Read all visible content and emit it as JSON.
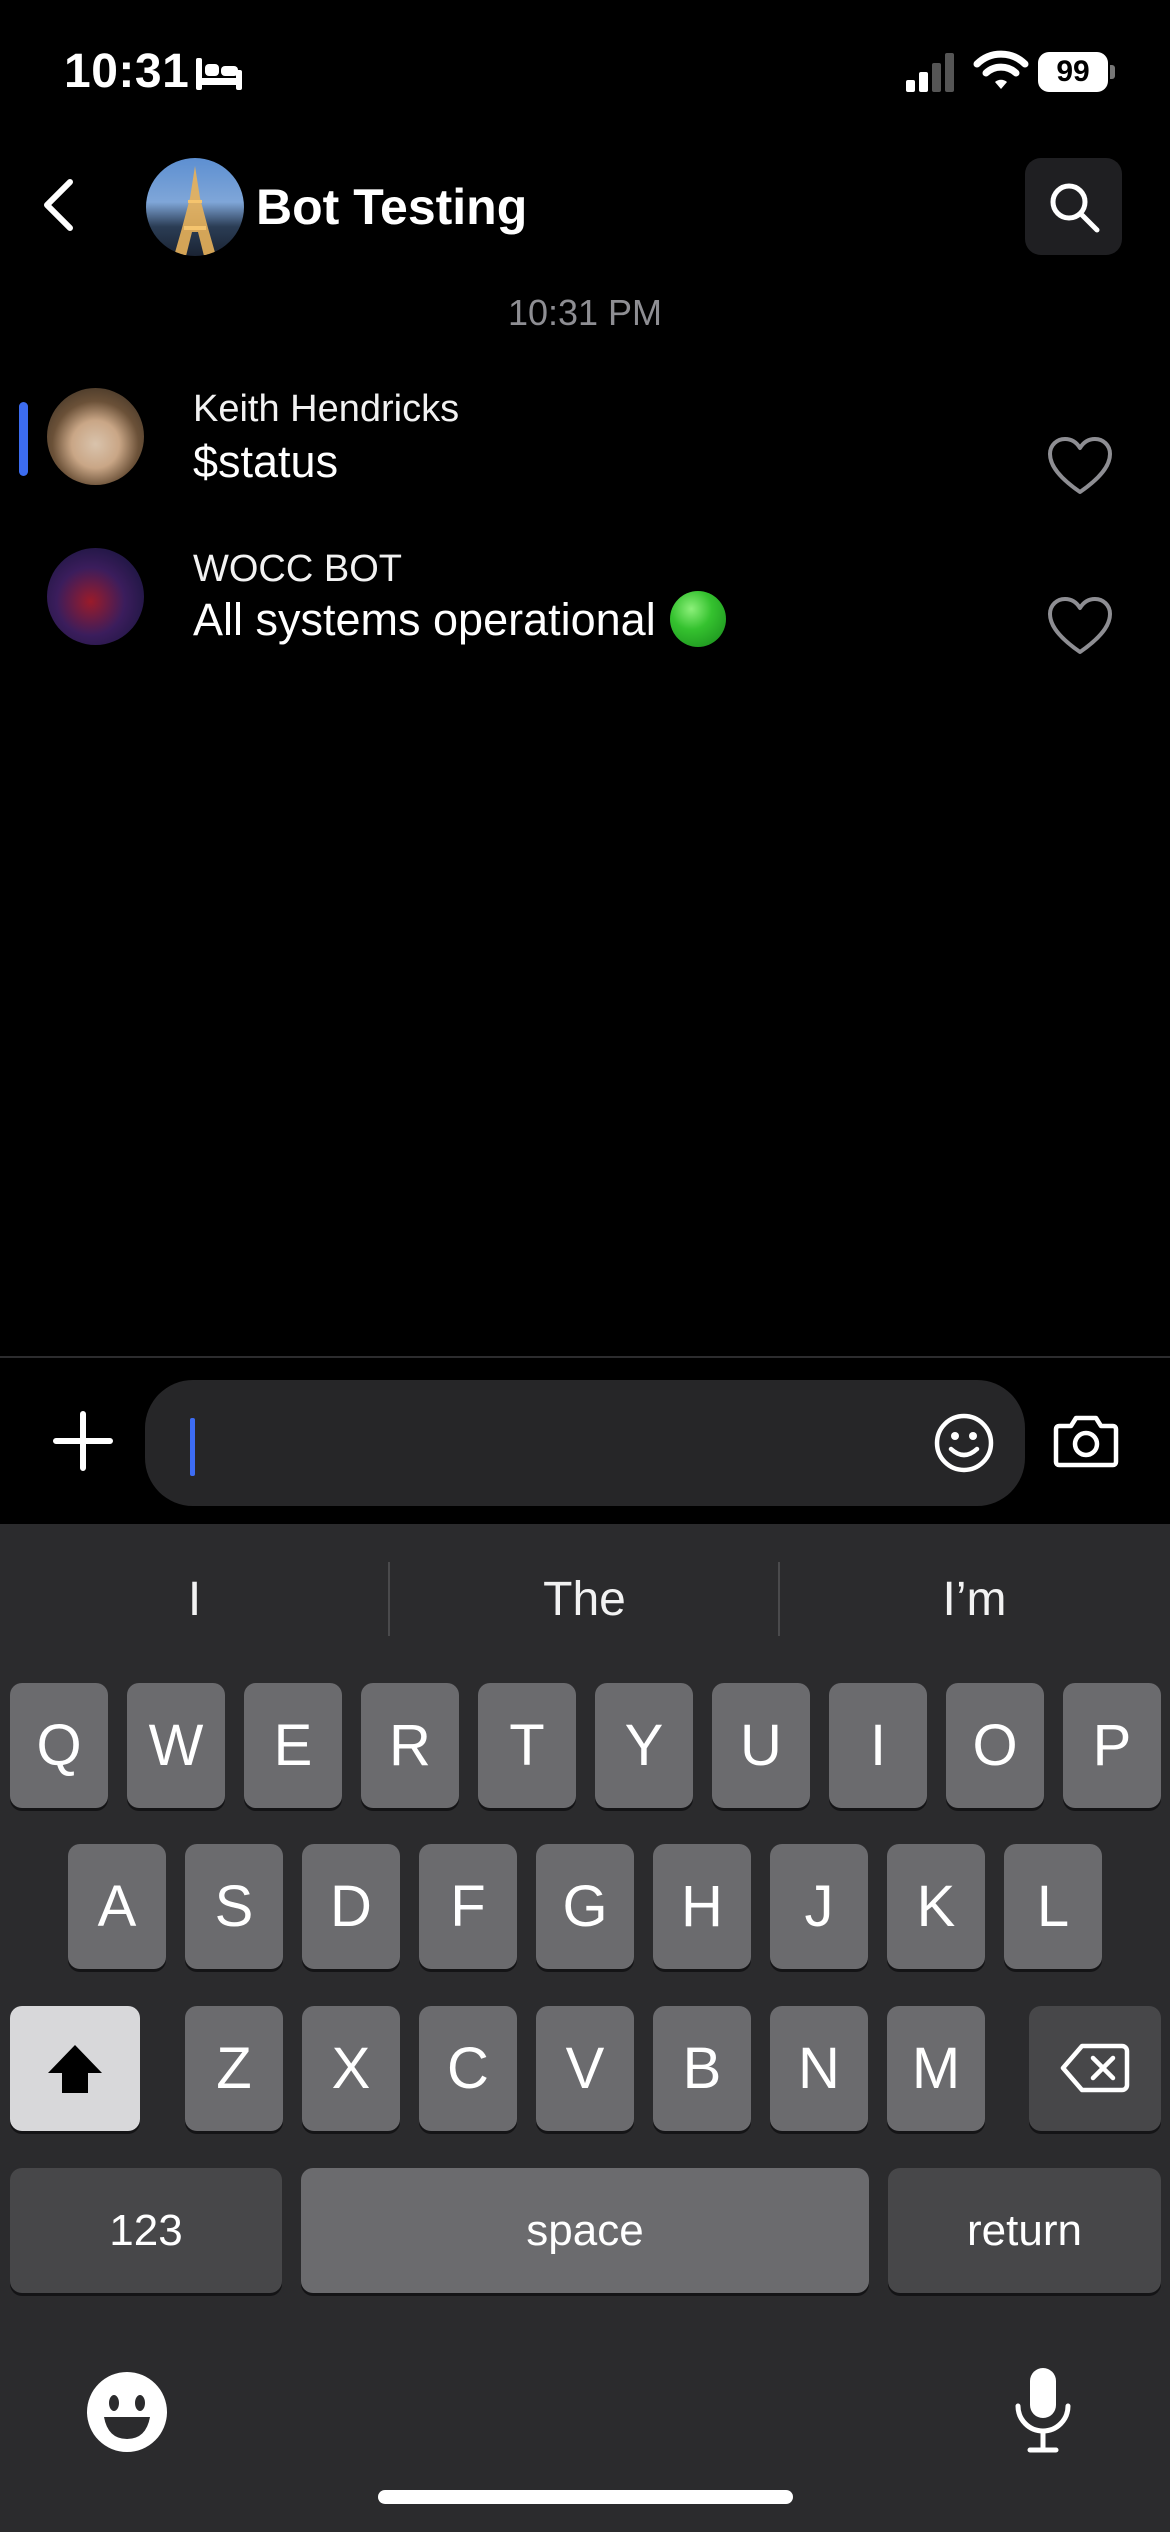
{
  "status_bar": {
    "time": "10:31",
    "battery": "99"
  },
  "header": {
    "title": "Bot Testing"
  },
  "chat": {
    "timestamp": "10:31 PM",
    "messages": [
      {
        "sender": "Keith Hendricks",
        "text": "$status"
      },
      {
        "sender": "WOCC BOT",
        "text": "All systems operational"
      }
    ]
  },
  "composer": {
    "value": ""
  },
  "keyboard": {
    "suggestions": [
      "I",
      "The",
      "I’m"
    ],
    "row1": [
      "Q",
      "W",
      "E",
      "R",
      "T",
      "Y",
      "U",
      "I",
      "O",
      "P"
    ],
    "row2": [
      "A",
      "S",
      "D",
      "F",
      "G",
      "H",
      "J",
      "K",
      "L"
    ],
    "row3": [
      "Z",
      "X",
      "C",
      "V",
      "B",
      "N",
      "M"
    ],
    "numbers_label": "123",
    "space_label": "space",
    "return_label": "return"
  },
  "colors": {
    "accent": "#3c6cf0",
    "status_green": "#35c22f",
    "background": "#000000",
    "keyboard_bg": "#2b2b2d"
  }
}
